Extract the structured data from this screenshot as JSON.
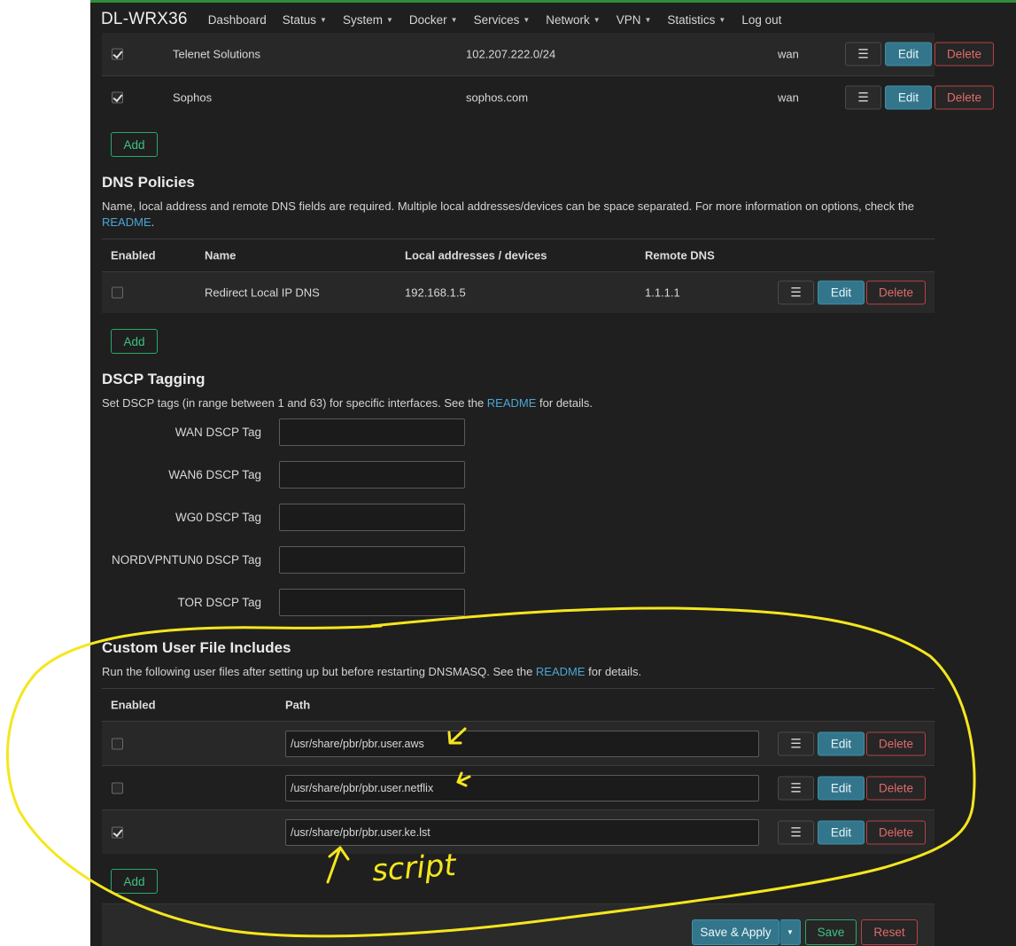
{
  "header": {
    "brand": "DL-WRX36",
    "nav": [
      {
        "label": "Dashboard",
        "dropdown": false
      },
      {
        "label": "Status",
        "dropdown": true
      },
      {
        "label": "System",
        "dropdown": true
      },
      {
        "label": "Docker",
        "dropdown": true
      },
      {
        "label": "Services",
        "dropdown": true
      },
      {
        "label": "Network",
        "dropdown": true
      },
      {
        "label": "VPN",
        "dropdown": true
      },
      {
        "label": "Statistics",
        "dropdown": true
      },
      {
        "label": "Log out",
        "dropdown": false
      }
    ]
  },
  "buttons": {
    "menu": "☰",
    "edit": "Edit",
    "delete": "Delete",
    "add": "Add"
  },
  "policies": {
    "rows": [
      {
        "enabled": true,
        "name": "Telenet Solutions",
        "dest": "102.207.222.0/24",
        "interface": "wan"
      },
      {
        "enabled": true,
        "name": "Sophos",
        "dest": "sophos.com",
        "interface": "wan"
      }
    ]
  },
  "dns_policies": {
    "title": "DNS Policies",
    "desc": "Name, local address and remote DNS fields are required. Multiple local addresses/devices can be space separated. For more information on options, check the ",
    "desc_link": "README",
    "desc_end": ".",
    "columns": [
      "Enabled",
      "Name",
      "Local addresses / devices",
      "Remote DNS"
    ],
    "rows": [
      {
        "enabled": false,
        "name": "Redirect Local IP DNS",
        "local": "192.168.1.5",
        "remote": "1.1.1.1"
      }
    ]
  },
  "dscp": {
    "title": "DSCP Tagging",
    "desc": "Set DSCP tags (in range between 1 and 63) for specific interfaces. See the ",
    "desc_link": "README",
    "desc_end": " for details.",
    "fields": [
      {
        "label": "WAN DSCP Tag",
        "value": ""
      },
      {
        "label": "WAN6 DSCP Tag",
        "value": ""
      },
      {
        "label": "WG0 DSCP Tag",
        "value": ""
      },
      {
        "label": "NORDVPNTUN0 DSCP Tag",
        "value": ""
      },
      {
        "label": "TOR DSCP Tag",
        "value": ""
      }
    ]
  },
  "includes": {
    "title": "Custom User File Includes",
    "desc": "Run the following user files after setting up but before restarting DNSMASQ. See the ",
    "desc_link": "README",
    "desc_end": " for details.",
    "columns": [
      "Enabled",
      "Path"
    ],
    "rows": [
      {
        "enabled": false,
        "path": "/usr/share/pbr/pbr.user.aws"
      },
      {
        "enabled": false,
        "path": "/usr/share/pbr/pbr.user.netflix"
      },
      {
        "enabled": true,
        "path": "/usr/share/pbr/pbr.user.ke.lst"
      }
    ]
  },
  "footer": {
    "save_apply": "Save & Apply",
    "save": "Save",
    "reset": "Reset"
  },
  "annotation": {
    "text": "script",
    "color": "#f5e61e"
  }
}
